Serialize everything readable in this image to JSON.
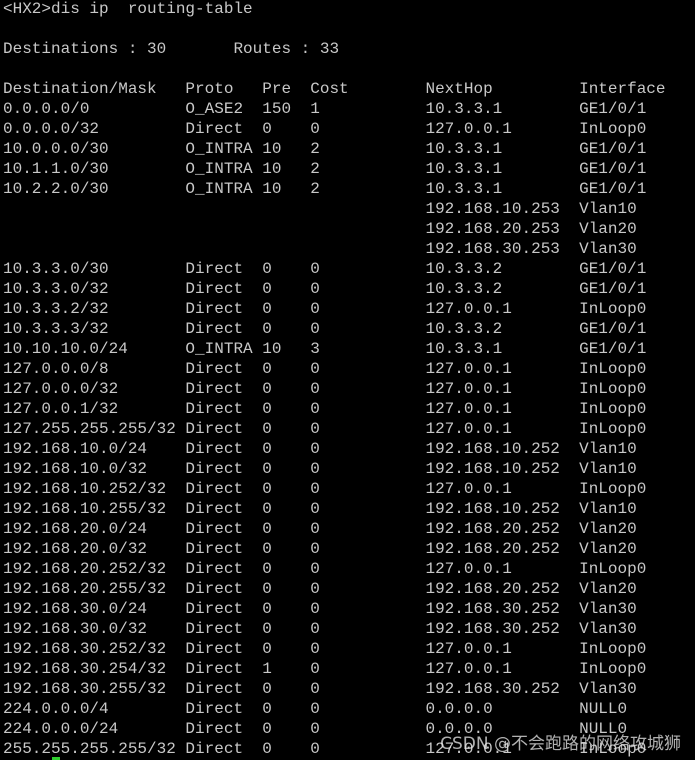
{
  "terminal": {
    "prompt": "<HX2>dis ip  routing-table",
    "summary": "Destinations : 30       Routes : 33",
    "header": "Destination/Mask   Proto   Pre  Cost        NextHop         Interface",
    "rows": [
      "0.0.0.0/0          O_ASE2  150  1           10.3.3.1        GE1/0/1",
      "0.0.0.0/32         Direct  0    0           127.0.0.1       InLoop0",
      "10.0.0.0/30        O_INTRA 10   2           10.3.3.1        GE1/0/1",
      "10.1.1.0/30        O_INTRA 10   2           10.3.3.1        GE1/0/1",
      "10.2.2.0/30        O_INTRA 10   2           10.3.3.1        GE1/0/1",
      "                                            192.168.10.253  Vlan10",
      "                                            192.168.20.253  Vlan20",
      "                                            192.168.30.253  Vlan30",
      "10.3.3.0/30        Direct  0    0           10.3.3.2        GE1/0/1",
      "10.3.3.0/32        Direct  0    0           10.3.3.2        GE1/0/1",
      "10.3.3.2/32        Direct  0    0           127.0.0.1       InLoop0",
      "10.3.3.3/32        Direct  0    0           10.3.3.2        GE1/0/1",
      "10.10.10.0/24      O_INTRA 10   3           10.3.3.1        GE1/0/1",
      "127.0.0.0/8        Direct  0    0           127.0.0.1       InLoop0",
      "127.0.0.0/32       Direct  0    0           127.0.0.1       InLoop0",
      "127.0.0.1/32       Direct  0    0           127.0.0.1       InLoop0",
      "127.255.255.255/32 Direct  0    0           127.0.0.1       InLoop0",
      "192.168.10.0/24    Direct  0    0           192.168.10.252  Vlan10",
      "192.168.10.0/32    Direct  0    0           192.168.10.252  Vlan10",
      "192.168.10.252/32  Direct  0    0           127.0.0.1       InLoop0",
      "192.168.10.255/32  Direct  0    0           192.168.10.252  Vlan10",
      "192.168.20.0/24    Direct  0    0           192.168.20.252  Vlan20",
      "192.168.20.0/32    Direct  0    0           192.168.20.252  Vlan20",
      "192.168.20.252/32  Direct  0    0           127.0.0.1       InLoop0",
      "192.168.20.255/32  Direct  0    0           192.168.20.252  Vlan20",
      "192.168.30.0/24    Direct  0    0           192.168.30.252  Vlan30",
      "192.168.30.0/32    Direct  0    0           192.168.30.252  Vlan30",
      "192.168.30.252/32  Direct  0    0           127.0.0.1       InLoop0",
      "192.168.30.254/32  Direct  1    0           127.0.0.1       InLoop0",
      "192.168.30.255/32  Direct  0    0           192.168.30.252  Vlan30",
      "224.0.0.0/4        Direct  0    0           0.0.0.0         NULL0",
      "224.0.0.0/24       Direct  0    0           0.0.0.0         NULL0",
      "255.255.255.255/32 Direct  0    0           127.0.0.1       InLoop0"
    ]
  },
  "watermark": "CSDN @不会跑路的网络攻城狮",
  "colors": {
    "background": "#000000",
    "text": "#c8c8c8",
    "cursor": "#2fd02f"
  }
}
